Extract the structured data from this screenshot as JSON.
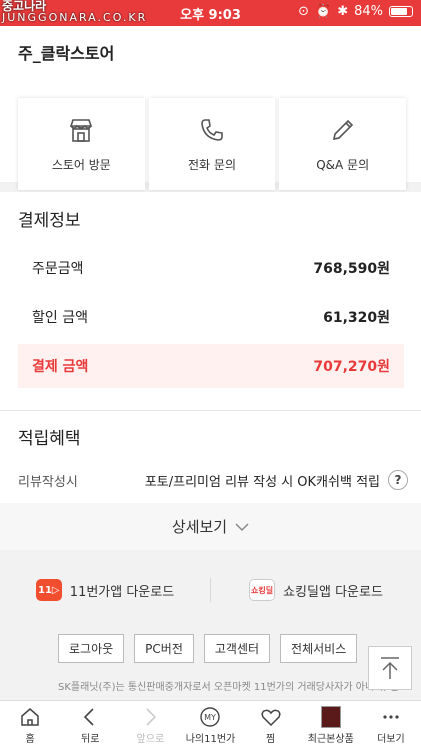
{
  "status_bar": {
    "watermark_top": "중고나라",
    "watermark_bottom": "JUNGGONARA.CO.KR",
    "time": "오후 9:03",
    "battery": "84%"
  },
  "store": {
    "title": "주_클락스토어",
    "buttons": [
      {
        "label": "스토어 방문",
        "icon": "store-icon"
      },
      {
        "label": "전화 문의",
        "icon": "phone-icon"
      },
      {
        "label": "Q&A 문의",
        "icon": "pencil-icon"
      }
    ]
  },
  "payment": {
    "title": "결제정보",
    "order_label": "주문금액",
    "order_value": "768,590원",
    "discount_label": "할인 금액",
    "discount_value": "61,320원",
    "total_label": "결제 금액",
    "total_value": "707,270원"
  },
  "reward": {
    "title": "적립혜택",
    "row_label": "리뷰작성시",
    "row_desc": "포토/프리미엄 리뷰 작성 시 OK캐쉬백 적립",
    "help": "?"
  },
  "detail_toggle": {
    "label": "상세보기"
  },
  "footer": {
    "app1_icon_text": "11▷",
    "app1_label": "11번가앱 다운로드",
    "app2_icon_text": "쇼킹딜",
    "app2_label": "쇼킹딜앱 다운로드",
    "links": [
      "로그아웃",
      "PC버전",
      "고객센터",
      "전체서비스"
    ],
    "legal": "SK플래닛(주)는 통신판매중개자로서 오픈마켓 11번가의 거래당사자가 아니며, 입"
  },
  "nav": {
    "items": [
      {
        "label": "홈",
        "icon": "home-icon"
      },
      {
        "label": "뒤로",
        "icon": "back-icon"
      },
      {
        "label": "앞으로",
        "icon": "forward-icon"
      },
      {
        "label": "나의11번가",
        "icon": "my-icon"
      },
      {
        "label": "찜",
        "icon": "heart-icon"
      },
      {
        "label": "최근본상품",
        "icon": "recent-product-thumb"
      },
      {
        "label": "더보기",
        "icon": "more-icon"
      }
    ]
  },
  "colors": {
    "accent": "#e83a3a",
    "total_bg": "#fff1ef"
  }
}
